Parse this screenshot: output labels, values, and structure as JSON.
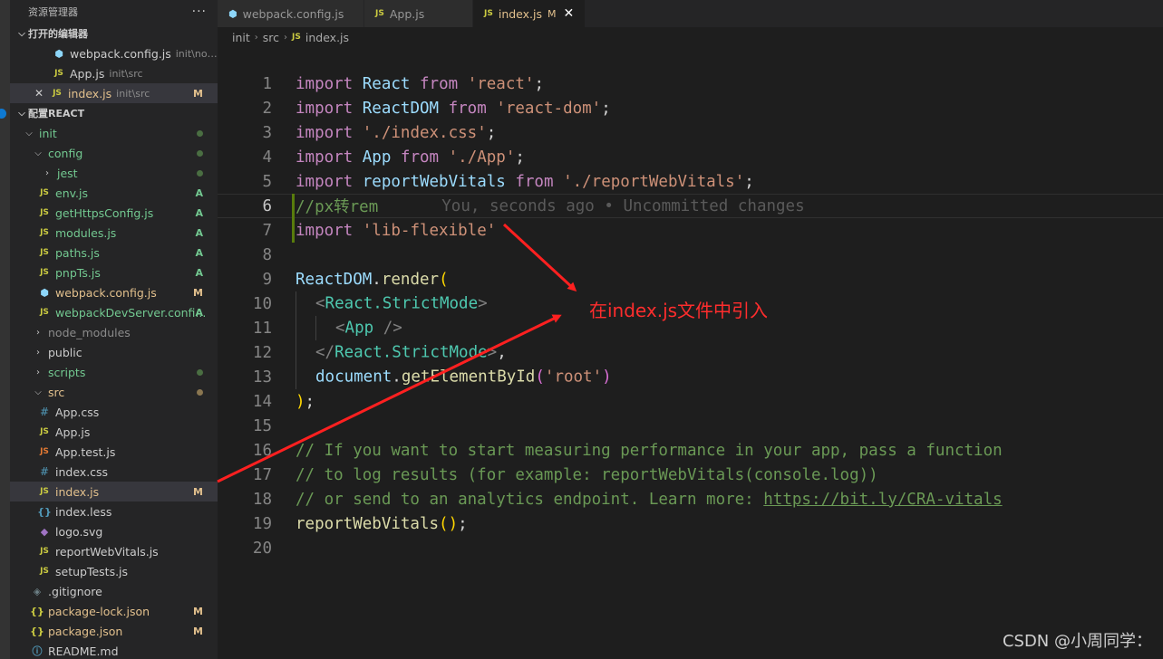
{
  "sidebar": {
    "header": "资源管理器",
    "more": "···",
    "open_editors_title": "打开的编辑器",
    "open_editors": [
      {
        "icon": "webpack-icon",
        "name": "webpack.config.js",
        "desc": "init\\node..."
      },
      {
        "icon": "js-icon",
        "name": "App.js",
        "desc": "init\\src"
      },
      {
        "icon": "js-icon",
        "name": "index.js",
        "desc": "init\\src",
        "badge": "M"
      }
    ],
    "project_title": "配置REACT",
    "tree": [
      {
        "name": "init",
        "type": "folder"
      },
      {
        "name": "config",
        "type": "folder"
      },
      {
        "name": "jest",
        "type": "folder"
      },
      {
        "name": "env.js",
        "badge": "A"
      },
      {
        "name": "getHttpsConfig.js",
        "badge": "A"
      },
      {
        "name": "modules.js",
        "badge": "A"
      },
      {
        "name": "paths.js",
        "badge": "A"
      },
      {
        "name": "pnpTs.js",
        "badge": "A"
      },
      {
        "name": "webpack.config.js",
        "badge": "M"
      },
      {
        "name": "webpackDevServer.confi...",
        "badge": "A"
      },
      {
        "name": "node_modules",
        "type": "folder"
      },
      {
        "name": "public",
        "type": "folder"
      },
      {
        "name": "scripts",
        "type": "folder"
      },
      {
        "name": "src",
        "type": "folder"
      },
      {
        "name": "App.css"
      },
      {
        "name": "App.js"
      },
      {
        "name": "App.test.js"
      },
      {
        "name": "index.css"
      },
      {
        "name": "index.js",
        "badge": "M"
      },
      {
        "name": "index.less"
      },
      {
        "name": "logo.svg"
      },
      {
        "name": "reportWebVitals.js"
      },
      {
        "name": "setupTests.js"
      },
      {
        "name": ".gitignore"
      },
      {
        "name": "package-lock.json",
        "badge": "M"
      },
      {
        "name": "package.json",
        "badge": "M"
      },
      {
        "name": "README.md"
      }
    ]
  },
  "tabs": [
    {
      "label": "webpack.config.js",
      "icon": "webpack-icon"
    },
    {
      "label": "App.js",
      "icon": "js-icon"
    },
    {
      "label": "index.js",
      "icon": "js-icon",
      "modified": "M",
      "close": "✕"
    }
  ],
  "breadcrumb": [
    "init",
    "src",
    "index.js"
  ],
  "editor": {
    "line_numbers": [
      "1",
      "2",
      "3",
      "4",
      "5",
      "6",
      "7",
      "8",
      "9",
      "10",
      "11",
      "12",
      "13",
      "14",
      "15",
      "16",
      "17",
      "18",
      "19",
      "20"
    ],
    "lines": [
      "import React from 'react';",
      "import ReactDOM from 'react-dom';",
      "import './index.css';",
      "import App from './App';",
      "import reportWebVitals from './reportWebVitals';",
      "//px转rem",
      "import 'lib-flexible'",
      "",
      "ReactDOM.render(",
      "  <React.StrictMode>",
      "    <App />",
      "  </React.StrictMode>,",
      "  document.getElementById('root')",
      ");",
      "",
      "// If you want to start measuring performance in your app, pass a function",
      "// to log results (for example: reportWebVitals(console.log))",
      "// or send to an analytics endpoint. Learn more: https://bit.ly/CRA-vitals",
      "reportWebVitals();",
      ""
    ],
    "blame": "You, seconds ago • Uncommitted changes",
    "link": "https://bit.ly/CRA-vitals"
  },
  "annotation": "在index.js文件中引入",
  "watermark": "CSDN @小周同学：",
  "colors": {
    "annotation": "#ff2d2d",
    "added_gutter": "#587c0c",
    "modified": "#e2c08d",
    "added": "#73c991"
  }
}
